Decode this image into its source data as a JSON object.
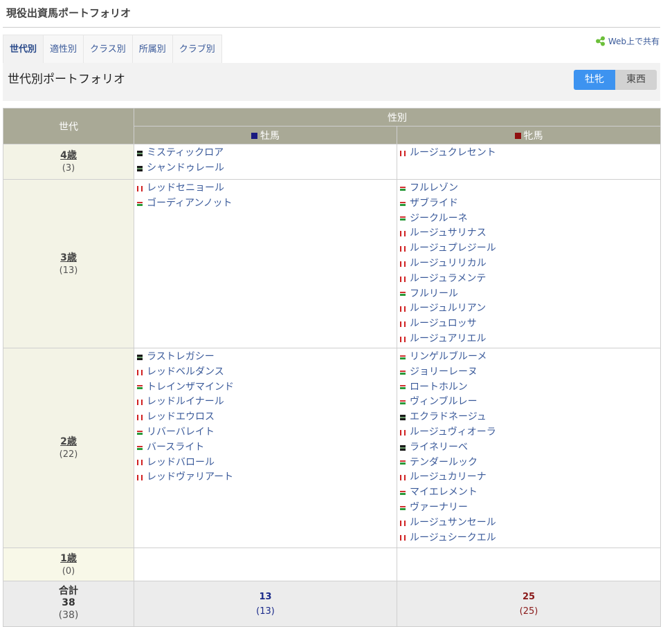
{
  "page": {
    "title": "現役出資馬ポートフォリオ"
  },
  "tabs": [
    "世代別",
    "適性別",
    "クラス別",
    "所属別",
    "クラブ別"
  ],
  "share": {
    "label": "Web上で共有"
  },
  "subhead": {
    "title": "世代別ポートフォリオ"
  },
  "toggle": {
    "active": "牡牝",
    "inactive": "東西",
    "active_color": "#3d93f0"
  },
  "table": {
    "header": {
      "gen": "世代",
      "sex": "性別",
      "male": "牡馬",
      "female": "牝馬"
    },
    "rows": [
      {
        "label": "4歳",
        "count": "(3)",
        "male": [
          {
            "name": "ミスティックロア",
            "silk": "black"
          },
          {
            "name": "シャンドゥレール",
            "silk": "black"
          }
        ],
        "female": [
          {
            "name": "ルージュクレセント",
            "silk": "red"
          }
        ]
      },
      {
        "label": "3歳",
        "count": "(13)",
        "male": [
          {
            "name": "レッドセニョール",
            "silk": "red"
          },
          {
            "name": "ゴーディアンノット",
            "silk": "green"
          }
        ],
        "female": [
          {
            "name": "フルレゾン",
            "silk": "green"
          },
          {
            "name": "ザブライド",
            "silk": "green"
          },
          {
            "name": "ジークルーネ",
            "silk": "green"
          },
          {
            "name": "ルージュサリナス",
            "silk": "red"
          },
          {
            "name": "ルージュプレジール",
            "silk": "red"
          },
          {
            "name": "ルージュリリカル",
            "silk": "red"
          },
          {
            "name": "ルージュラメンテ",
            "silk": "red"
          },
          {
            "name": "フルリール",
            "silk": "green"
          },
          {
            "name": "ルージュルリアン",
            "silk": "red"
          },
          {
            "name": "ルージュロッサ",
            "silk": "red"
          },
          {
            "name": "ルージュアリエル",
            "silk": "red"
          }
        ]
      },
      {
        "label": "2歳",
        "count": "(22)",
        "male": [
          {
            "name": "ラストレガシー",
            "silk": "black"
          },
          {
            "name": "レッドベルダンス",
            "silk": "red"
          },
          {
            "name": "トレインザマインド",
            "silk": "green"
          },
          {
            "name": "レッドルイナール",
            "silk": "red"
          },
          {
            "name": "レッドエウロス",
            "silk": "red"
          },
          {
            "name": "リバーバレイト",
            "silk": "green"
          },
          {
            "name": "バースライト",
            "silk": "green"
          },
          {
            "name": "レッドバロール",
            "silk": "red"
          },
          {
            "name": "レッドヴァリアート",
            "silk": "red"
          }
        ],
        "female": [
          {
            "name": "リンゲルブルーメ",
            "silk": "green"
          },
          {
            "name": "ジョリーレーヌ",
            "silk": "green"
          },
          {
            "name": "ロートホルン",
            "silk": "green"
          },
          {
            "name": "ヴィンブルレー",
            "silk": "green"
          },
          {
            "name": "エクラドネージュ",
            "silk": "black"
          },
          {
            "name": "ルージュヴィオーラ",
            "silk": "red"
          },
          {
            "name": "ライネリーベ",
            "silk": "black"
          },
          {
            "name": "テンダールック",
            "silk": "green"
          },
          {
            "name": "ルージュカリーナ",
            "silk": "red"
          },
          {
            "name": "マイエレメント",
            "silk": "green"
          },
          {
            "name": "ヴァーナリー",
            "silk": "green"
          },
          {
            "name": "ルージュサンセール",
            "silk": "red"
          },
          {
            "name": "ルージュシークエル",
            "silk": "red"
          }
        ]
      },
      {
        "label": "1歳",
        "count": "(0)",
        "male": [],
        "female": []
      }
    ],
    "total": {
      "label": "合計",
      "value": "38",
      "count": "(38)",
      "male": "13",
      "male_count": "(13)",
      "female": "25",
      "female_count": "(25)"
    }
  }
}
